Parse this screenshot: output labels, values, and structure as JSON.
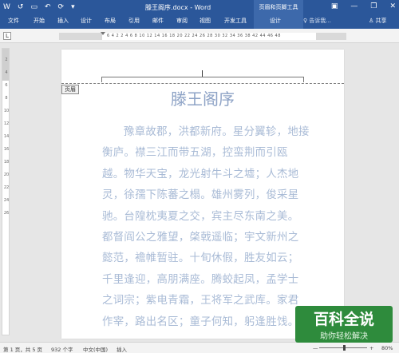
{
  "titlebar": {
    "qat": [
      "W",
      "↺",
      "▭",
      "↶",
      "⟳",
      "▾"
    ],
    "title": "滕王阁序.docx - Word",
    "context_title": "页眉和页脚工具",
    "window_buttons": [
      "▣",
      "—",
      "❐",
      "✕"
    ]
  },
  "tabs": [
    "文件",
    "开始",
    "插入",
    "设计",
    "布局",
    "引用",
    "邮件",
    "审阅",
    "视图",
    "开发工具",
    "设计"
  ],
  "tellme": "♀ 告诉我...",
  "share": "♙ 共享",
  "ruler": {
    "tab_selector": "L",
    "numbers": "6 4 2 2 4 6 8 10 12 14 16 18 20 22 24 26 28 30 32 34 36 38 42 44 46 48"
  },
  "vruler_numbers": [
    "2",
    "4",
    "6",
    "8",
    "10",
    "12",
    "14",
    "16",
    "18",
    "20",
    "22",
    "24",
    "26"
  ],
  "document": {
    "header_tag": "页眉",
    "heading": "滕王阁序",
    "body": "豫章故郡，洪都新府。星分翼轸，地接衡庐。襟三江而带五湖，控蛮荆而引瓯越。物华天宝，龙光射牛斗之墟；人杰地灵，徐孺下陈蕃之榻。雄州雾列，俊采星驰。台隍枕夷夏之交，宾主尽东南之美。都督阎公之雅望，棨戟遥临；宇文新州之懿范，襜帷暂驻。十旬休假，胜友如云；千里逢迎，高朋满座。腾蛟起凤，孟学士之词宗；紫电青霜，王将军之武库。家君作宰，路出名区；童子何知，躬逢胜饯。"
  },
  "status": {
    "page": "第 1 页，共 5 页",
    "words": "932 个字",
    "lang": "中文(中国)",
    "mode": "插入",
    "zoom_minus": "—",
    "zoom_plus": "+",
    "zoom": "80%"
  },
  "watermark": {
    "title": "百科全说",
    "subtitle": "助你轻松解决"
  },
  "colors": {
    "ribbon": "#2b579a",
    "heading": "#8ea3c6",
    "body_text": "#a9bbd6",
    "watermark": "#2e8b3c"
  }
}
